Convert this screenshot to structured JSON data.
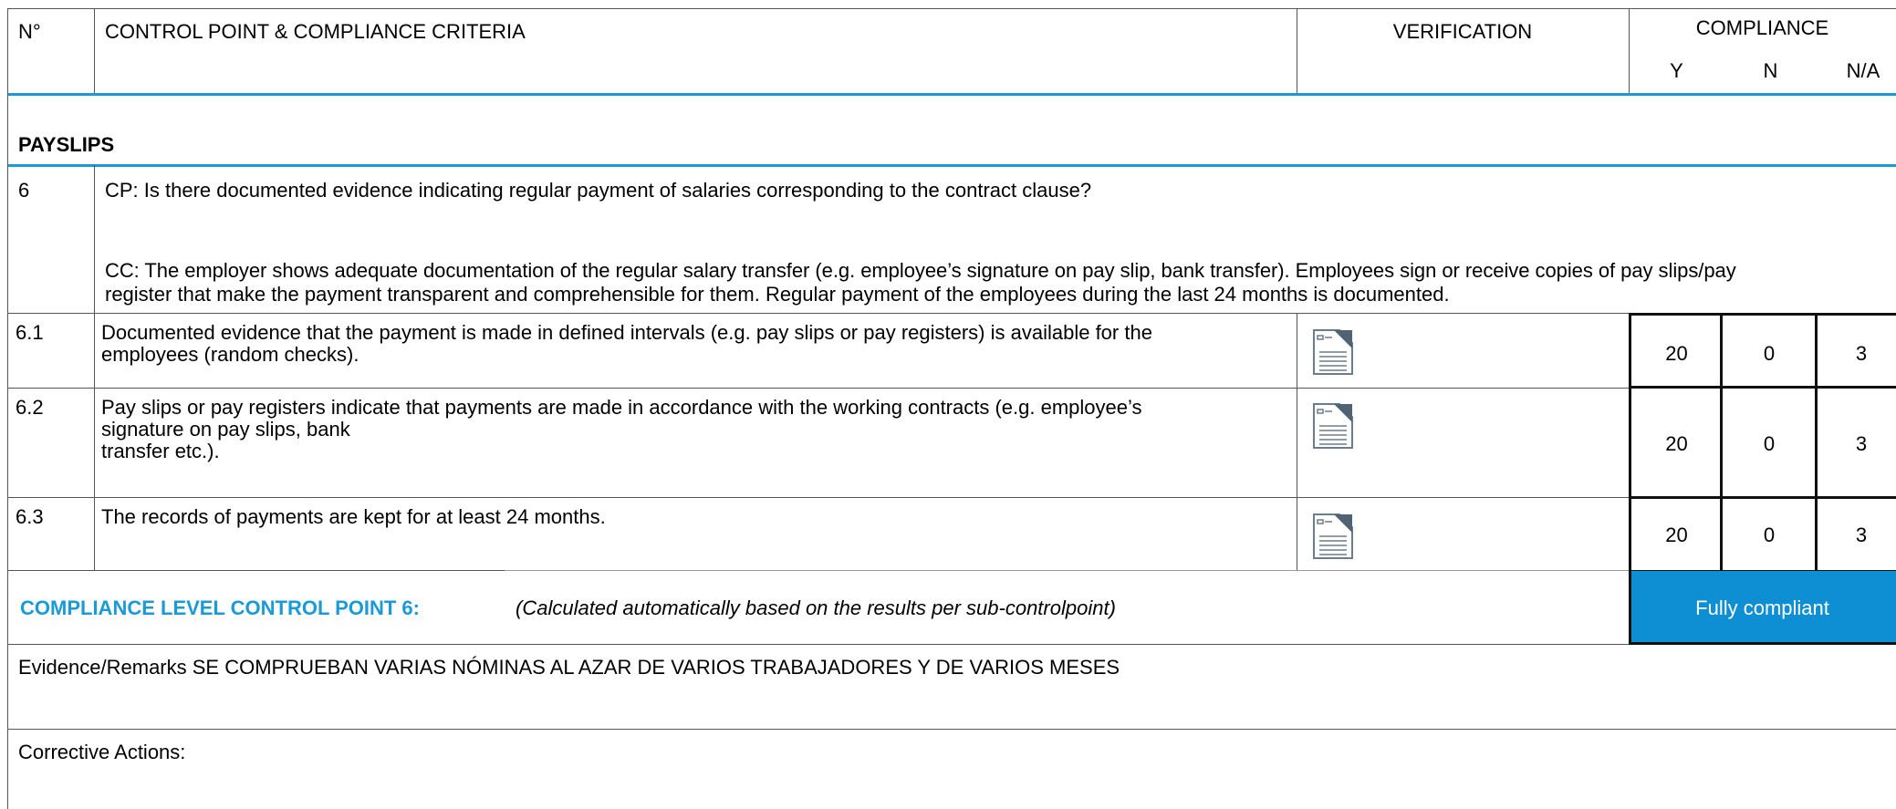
{
  "header": {
    "col_no": "N°",
    "col_criteria": "CONTROL POINT & COMPLIANCE CRITERIA",
    "col_verification": "VERIFICATION",
    "col_compliance": "COMPLIANCE",
    "col_y": "Y",
    "col_n": "N",
    "col_na": "N/A"
  },
  "section": {
    "title": "PAYSLIPS"
  },
  "control_point": {
    "number": "6",
    "cp_text": "CP: Is there documented evidence indicating regular payment of salaries corresponding to the contract clause?",
    "cc_line1": "CC: The employer shows adequate documentation of the regular salary transfer (e.g. employee’s signature on pay slip, bank transfer). Employees sign or receive copies of pay slips/pay",
    "cc_line2": "register that make the payment transparent and comprehensible for them. Regular payment of the employees during the last 24 months is documented."
  },
  "rows": [
    {
      "number": "6.1",
      "line1": "Documented evidence that the payment is made in defined intervals (e.g. pay slips or pay registers) is available for the",
      "line2": "employees (random checks).",
      "line3": "",
      "y": "20",
      "n": "0",
      "na": "3",
      "icon": "document-icon"
    },
    {
      "number": "6.2",
      "line1": "Pay slips or pay registers indicate that payments are made in accordance with the working contracts (e.g. employee’s",
      "line2": "signature on pay slips, bank",
      "line3": "transfer etc.).",
      "y": "20",
      "n": "0",
      "na": "3",
      "icon": "document-icon"
    },
    {
      "number": "6.3",
      "line1": "The records of payments are kept for at least 24 months.",
      "line2": "",
      "line3": "",
      "y": "20",
      "n": "0",
      "na": "3",
      "icon": "document-icon"
    }
  ],
  "compliance_level": {
    "label": "COMPLIANCE LEVEL CONTROL POINT 6:",
    "note": "(Calculated automatically based on the results per sub-controlpoint)",
    "result": "Fully compliant"
  },
  "evidence": {
    "text": "Evidence/Remarks SE COMPRUEBAN VARIAS NÓMINAS AL AZAR DE VARIOS TRABAJADORES Y DE VARIOS MESES"
  },
  "corrective": {
    "label": "Corrective Actions:"
  },
  "colors": {
    "accent_blue": "#1a9ad6",
    "result_bg": "#0f8fd3",
    "label_blue": "#1a9ad6"
  }
}
